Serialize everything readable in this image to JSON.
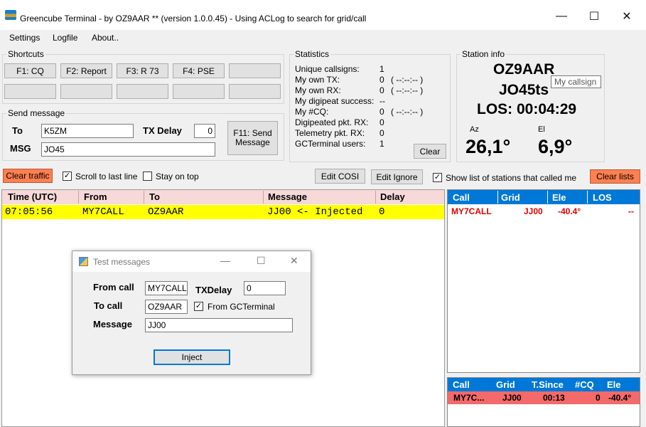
{
  "window": {
    "title": "Greencube Terminal - by OZ9AAR ** (version 1.0.0.45) - Using ACLog to search for grid/call",
    "minimize": "—",
    "maximize": "☐",
    "close": "✕"
  },
  "menu": [
    "Settings",
    "Logfile",
    "About.."
  ],
  "shortcuts": {
    "title": "Shortcuts",
    "buttons": [
      "F1: CQ",
      "F2: Report",
      "F3: R 73",
      "F4: PSE"
    ]
  },
  "send_message": {
    "title": "Send message",
    "to_label": "To",
    "to_value": "K5ZM",
    "tx_delay_label": "TX Delay",
    "tx_delay_value": "0",
    "msg_label": "MSG",
    "msg_value": "JO45",
    "send_button": "F11: Send Message"
  },
  "statistics": {
    "title": "Statistics",
    "rows": [
      {
        "label": "Unique callsigns:",
        "value": "1",
        "time": ""
      },
      {
        "label": "My own TX:",
        "value": "0",
        "time": "( --:--:-- )"
      },
      {
        "label": "My own RX:",
        "value": "0",
        "time": "( --:--:-- )"
      },
      {
        "label": "My digipeat success:",
        "value": "--",
        "time": ""
      },
      {
        "label": "My #CQ:",
        "value": "0",
        "time": "( --:--:-- )"
      },
      {
        "label": "Digipeated pkt. RX:",
        "value": "0",
        "time": ""
      },
      {
        "label": "Telemetry pkt. RX:",
        "value": "0",
        "time": ""
      },
      {
        "label": "GCTerminal users:",
        "value": "1",
        "time": ""
      }
    ],
    "clear_button": "Clear"
  },
  "station_info": {
    "title": "Station info",
    "callsign": "OZ9AAR",
    "grid": "JO45ts",
    "los": "LOS: 00:04:29",
    "az_label": "Az",
    "az_value": "26,1°",
    "el_label": "El",
    "el_value": "6,9°",
    "tooltip": "My callsign"
  },
  "toolbar": {
    "clear_traffic": "Clear traffic",
    "scroll_to_last_line": "Scroll to last line",
    "scroll_checked": true,
    "stay_on_top": "Stay on top",
    "stay_checked": false,
    "edit_cosi": "Edit COSI",
    "edit_ignore": "Edit Ignore",
    "show_list": "Show list of stations that called me",
    "show_list_checked": true,
    "clear_lists": "Clear lists"
  },
  "log_table": {
    "headers": [
      "Time (UTC)",
      "From",
      "To",
      "Message",
      "Delay"
    ],
    "rows": [
      {
        "time": "07:05:56",
        "from": "MY7CALL",
        "to": "OZ9AAR",
        "message": "JJ00 <- Injected",
        "delay": "0"
      }
    ]
  },
  "stations_table": {
    "headers": [
      "Call",
      "Grid",
      "Ele",
      "LOS"
    ],
    "rows": [
      {
        "call": "MY7CALL",
        "grid": "JJ00",
        "ele": "-40.4°",
        "los": "--"
      }
    ]
  },
  "called_me_table": {
    "headers": [
      "Call",
      "Grid",
      "T.Since",
      "#CQ",
      "Ele"
    ],
    "rows": [
      {
        "call": "MY7C...",
        "grid": "JJ00",
        "tsince": "00:13",
        "cq": "0",
        "ele": "-40.4°"
      }
    ]
  },
  "test_dialog": {
    "title": "Test messages",
    "from_call_label": "From call",
    "from_call_value": "MY7CALL",
    "txdelay_label": "TXDelay",
    "txdelay_value": "0",
    "to_call_label": "To call",
    "to_call_value": "OZ9AAR",
    "from_gcterminal": "From GCTerminal",
    "from_gcterminal_checked": true,
    "message_label": "Message",
    "message_value": "JJ00",
    "inject_button": "Inject",
    "minimize": "—",
    "maximize": "☐",
    "close": "✕"
  },
  "colors": {
    "accent": "#0078d7",
    "orange_button": "#ff7f50",
    "highlight_row": "#ffff00",
    "log_header": "#f7d9d9",
    "call_red": "#e00000"
  }
}
